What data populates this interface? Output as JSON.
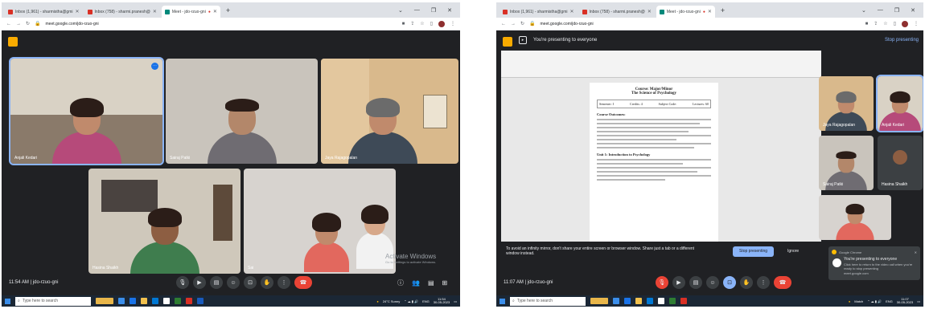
{
  "left": {
    "tabs": [
      {
        "label": "Inbox (1,961) - sharmistha@gmi"
      },
      {
        "label": "Inbox (758) - sharmi.pranesh@"
      },
      {
        "label": "Meet - jdo-rzuo-gni"
      }
    ],
    "url": "meet.google.com/jdo-rzuo-gni",
    "participants": [
      {
        "name": "Anjali Kedari"
      },
      {
        "name": "Sairaj Patki"
      },
      {
        "name": "Jaya Rajagopalan"
      },
      {
        "name": "Hasina Shaikh"
      },
      {
        "name": "Sai"
      }
    ],
    "meeting_info": "11:54 AM  |  jdo-rzuo-gni",
    "watermark_title": "Activate Windows",
    "watermark_sub": "Go to Settings to activate Windows.",
    "taskbar_search": "Type here to search",
    "weather": "24°C  Sunny",
    "lang": "ENG",
    "time": "11:54",
    "date": "30-05-2023"
  },
  "right": {
    "tabs": [
      {
        "label": "Inbox (1,961) - sharmistha@gmi"
      },
      {
        "label": "Inbox (758) - sharmi.pranesh@"
      },
      {
        "label": "Meet - jdo-rzuo-gni"
      }
    ],
    "url": "meet.google.com/jdo-rzuo-gni",
    "presenting_text": "You're presenting to everyone",
    "stop_presenting_link": "Stop presenting",
    "doc": {
      "title_line1": "Course: Major/Minor",
      "title_line2": "The Science of Psychology",
      "semester": "Semester: I",
      "credits": "Credits: 4",
      "subject_code": "Subject Code:",
      "lectures": "Lectures: 60",
      "section1": "Course Outcomes:",
      "section2": "Unit 1: Introduction to Psychology"
    },
    "infinity_warning": "To avoid an infinity mirror, don't share your entire screen or browser window. Share just a tab or a different window instead.",
    "stop_btn": "Stop presenting",
    "ignore_btn": "Ignore",
    "participants": [
      {
        "name": "Jaya Rajagopalan"
      },
      {
        "name": "Anjali Kedari"
      },
      {
        "name": "Sairaj Patki"
      },
      {
        "name": "Hasina Shaikh"
      }
    ],
    "notif_app": "Google Chrome",
    "notif_title": "You're presenting to everyone",
    "notif_body": "Click here to return to the video call when you're ready to stop presenting",
    "notif_site": "meet.google.com",
    "meeting_info": "11:07 AM  |  jdo-rzuo-gni",
    "taskbar_search": "Type here to search",
    "weather": "Match",
    "lang": "ENG",
    "time": "11:07",
    "date": "30-05-2023"
  }
}
